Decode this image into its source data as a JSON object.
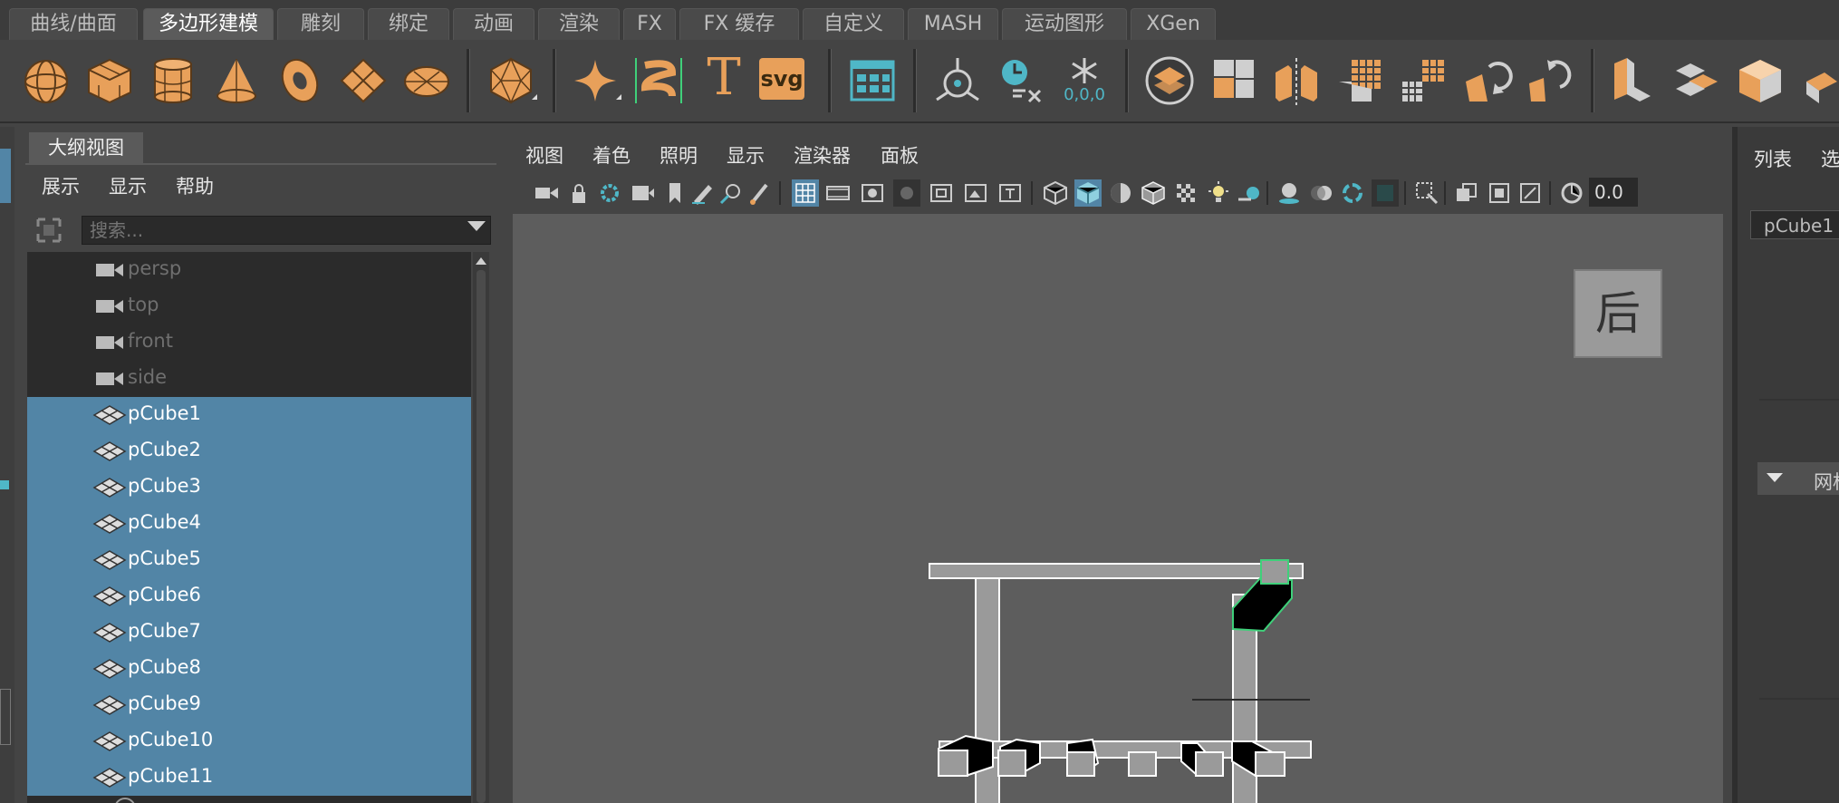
{
  "shelf_tabs": [
    "曲线/曲面",
    "多边形建模",
    "雕刻",
    "绑定",
    "动画",
    "渲染",
    "FX",
    "FX 缓存",
    "自定义",
    "MASH",
    "运动图形",
    "XGen"
  ],
  "active_tab": "多边形建模",
  "shelf": {
    "text_tool_label": "T",
    "svg_tool_label": "svg",
    "freeze_label": "0,0,0"
  },
  "outliner": {
    "tab_label": "大纲视图",
    "menu": [
      "展示",
      "显示",
      "帮助"
    ],
    "search_placeholder": "搜索...",
    "cameras": [
      "persp",
      "top",
      "front",
      "side"
    ],
    "objects": [
      "pCube1",
      "pCube2",
      "pCube3",
      "pCube4",
      "pCube5",
      "pCube6",
      "pCube7",
      "pCube8",
      "pCube9",
      "pCube10",
      "pCube11"
    ]
  },
  "viewport": {
    "menu": [
      "视图",
      "着色",
      "照明",
      "显示",
      "渲染器",
      "面板"
    ],
    "exposure_value": "0.0",
    "view_cube_label": "后"
  },
  "right_panel": {
    "tabs": [
      "列表",
      "选"
    ],
    "node_field": "pCube1",
    "section_label": "网格"
  },
  "colors": {
    "accent_orange": "#e8a05a",
    "selection_blue": "#5285a6",
    "accent_teal": "#4fb7c7",
    "highlight_green": "#3fd07a"
  }
}
